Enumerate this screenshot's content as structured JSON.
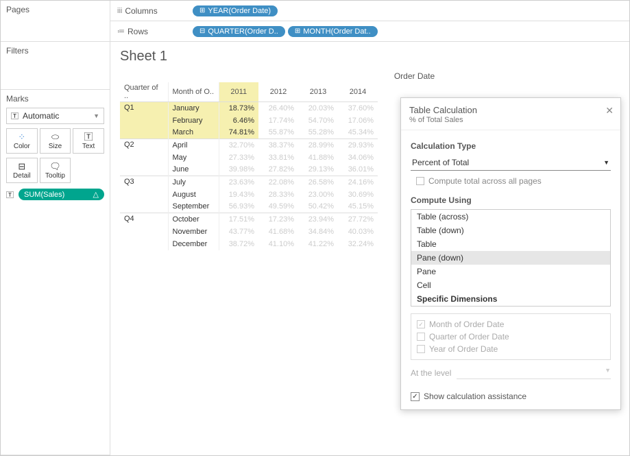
{
  "panels": {
    "pages": "Pages",
    "filters": "Filters",
    "marks": "Marks"
  },
  "marks": {
    "type": "Automatic",
    "buttons": {
      "color": "Color",
      "size": "Size",
      "text": "Text",
      "detail": "Detail",
      "tooltip": "Tooltip"
    },
    "pill": "SUM(Sales)"
  },
  "shelves": {
    "columns": {
      "label": "Columns",
      "pills": [
        "YEAR(Order Date)"
      ]
    },
    "rows": {
      "label": "Rows",
      "pills": [
        "QUARTER(Order D..",
        "MONTH(Order Dat.."
      ]
    }
  },
  "sheet": {
    "title": "Sheet 1",
    "super": "Order Date"
  },
  "table": {
    "col_headers": [
      "Quarter of ..",
      "Month of O..",
      "2011",
      "2012",
      "2013",
      "2014"
    ],
    "rows": [
      {
        "q": "Q1",
        "month": "January",
        "y2011": "18.73%",
        "y2012": "26.40%",
        "y2013": "20.03%",
        "y2014": "37.60%",
        "hl": true,
        "qstart": true
      },
      {
        "q": "",
        "month": "February",
        "y2011": "6.46%",
        "y2012": "17.74%",
        "y2013": "54.70%",
        "y2014": "17.06%",
        "hl": true
      },
      {
        "q": "",
        "month": "March",
        "y2011": "74.81%",
        "y2012": "55.87%",
        "y2013": "55.28%",
        "y2014": "45.34%",
        "hl": true
      },
      {
        "q": "Q2",
        "month": "April",
        "y2011": "32.70%",
        "y2012": "38.37%",
        "y2013": "28.99%",
        "y2014": "29.93%",
        "qstart": true
      },
      {
        "q": "",
        "month": "May",
        "y2011": "27.33%",
        "y2012": "33.81%",
        "y2013": "41.88%",
        "y2014": "34.06%"
      },
      {
        "q": "",
        "month": "June",
        "y2011": "39.98%",
        "y2012": "27.82%",
        "y2013": "29.13%",
        "y2014": "36.01%"
      },
      {
        "q": "Q3",
        "month": "July",
        "y2011": "23.63%",
        "y2012": "22.08%",
        "y2013": "26.58%",
        "y2014": "24.16%",
        "qstart": true
      },
      {
        "q": "",
        "month": "August",
        "y2011": "19.43%",
        "y2012": "28.33%",
        "y2013": "23.00%",
        "y2014": "30.69%"
      },
      {
        "q": "",
        "month": "September",
        "y2011": "56.93%",
        "y2012": "49.59%",
        "y2013": "50.42%",
        "y2014": "45.15%"
      },
      {
        "q": "Q4",
        "month": "October",
        "y2011": "17.51%",
        "y2012": "17.23%",
        "y2013": "23.94%",
        "y2014": "27.72%",
        "qstart": true
      },
      {
        "q": "",
        "month": "November",
        "y2011": "43.77%",
        "y2012": "41.68%",
        "y2013": "34.84%",
        "y2014": "40.03%"
      },
      {
        "q": "",
        "month": "December",
        "y2011": "38.72%",
        "y2012": "41.10%",
        "y2013": "41.22%",
        "y2014": "32.24%"
      }
    ]
  },
  "dialog": {
    "title": "Table Calculation",
    "subtitle": "% of Total Sales",
    "calc_type_label": "Calculation Type",
    "calc_type_value": "Percent of Total",
    "compute_total": "Compute total across all pages",
    "compute_using_label": "Compute Using",
    "options": [
      "Table (across)",
      "Table (down)",
      "Table",
      "Pane (down)",
      "Pane",
      "Cell",
      "Specific Dimensions"
    ],
    "selected_option": "Pane (down)",
    "dims": [
      "Month of Order Date",
      "Quarter of Order Date",
      "Year of Order Date"
    ],
    "at_level": "At the level",
    "show_assist": "Show calculation assistance"
  }
}
